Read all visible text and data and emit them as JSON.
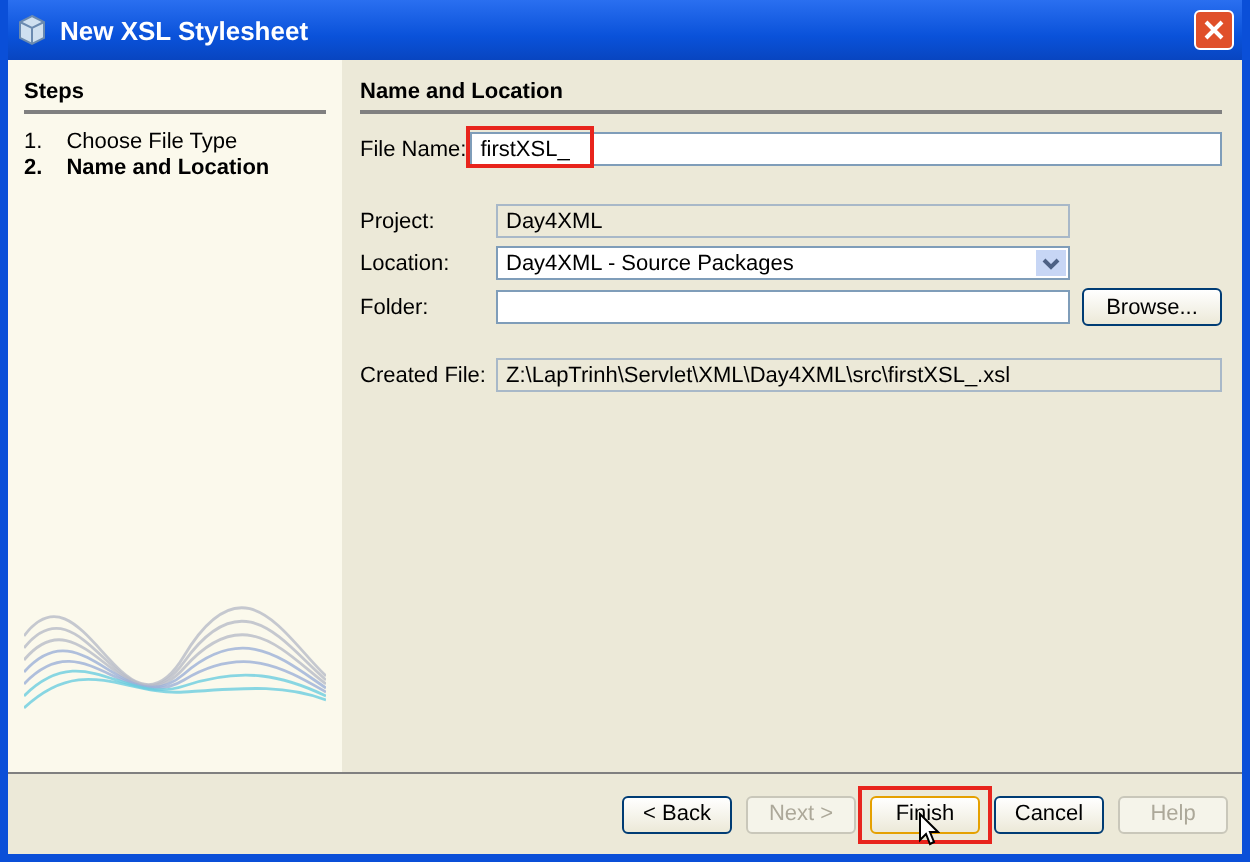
{
  "window": {
    "title": "New XSL Stylesheet"
  },
  "steps": {
    "title": "Steps",
    "items": [
      {
        "number": "1.",
        "label": "Choose File Type",
        "selected": false
      },
      {
        "number": "2.",
        "label": "Name and Location",
        "selected": true
      }
    ]
  },
  "panel": {
    "title": "Name and Location",
    "fields": [
      {
        "kind": "text",
        "label": "File Name:",
        "value": "firstXSL_",
        "highlighted": true
      },
      {
        "kind": "readonly",
        "label": "Project:",
        "value": "Day4XML"
      },
      {
        "kind": "combo",
        "label": "Location:",
        "value": "Day4XML - Source Packages"
      },
      {
        "kind": "browse",
        "label": "Folder:",
        "button": "Browse..."
      },
      {
        "kind": "output",
        "label": "Created File:",
        "value": "Z:\\LapTrinh\\Servlet\\XML\\Day4XML\\src\\firstXSL_.xsl"
      }
    ]
  },
  "buttons": [
    {
      "label": "< Back",
      "disabled": false,
      "highlighted": false
    },
    {
      "label": "Next >",
      "disabled": true,
      "highlighted": false
    },
    {
      "label": "Finish",
      "disabled": false,
      "highlighted": true
    },
    {
      "label": "Cancel",
      "disabled": false,
      "highlighted": false
    },
    {
      "label": "Help",
      "disabled": true,
      "highlighted": false
    }
  ]
}
